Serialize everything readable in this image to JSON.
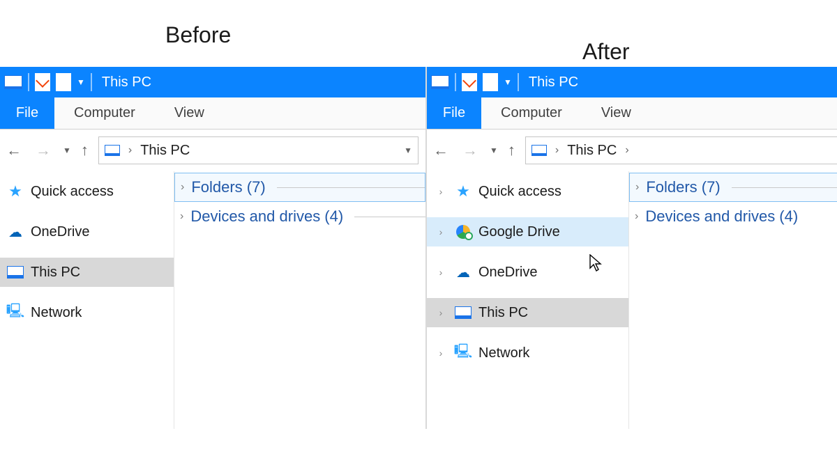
{
  "labels": {
    "before": "Before",
    "after": "After"
  },
  "titlebar": {
    "title": "This PC"
  },
  "ribbon": {
    "file": "File",
    "computer": "Computer",
    "view": "View"
  },
  "breadcrumb": {
    "location": "This PC"
  },
  "sidebar_before": {
    "quick_access": "Quick access",
    "onedrive": "OneDrive",
    "this_pc": "This PC",
    "network": "Network"
  },
  "sidebar_after": {
    "quick_access": "Quick access",
    "google_drive": "Google Drive",
    "onedrive": "OneDrive",
    "this_pc": "This PC",
    "network": "Network"
  },
  "content_groups": {
    "folders": "Folders (7)",
    "devices": "Devices and drives (4)"
  }
}
